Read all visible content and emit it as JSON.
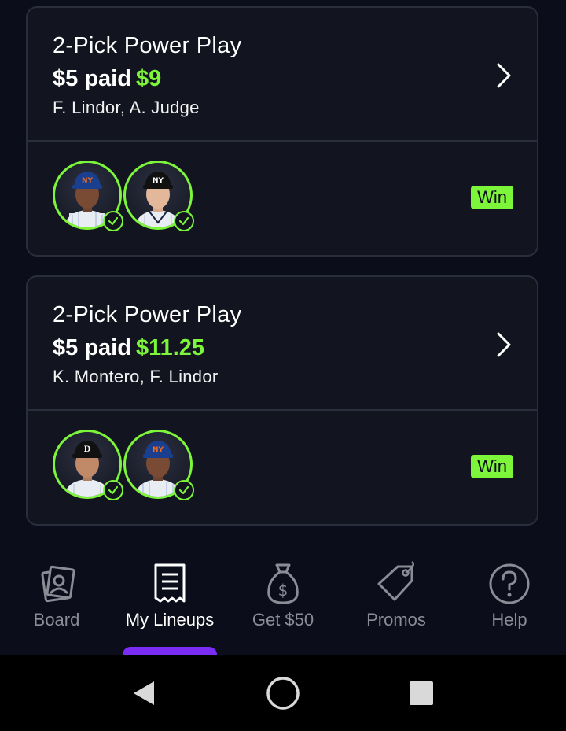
{
  "lineups": [
    {
      "title": "2-Pick Power Play",
      "paid_label": "$5 paid",
      "payout": "$9",
      "players": "F. Lindor, A. Judge",
      "avatars": [
        {
          "team": "mets",
          "cap_color": "#1b3f8f",
          "logo_color": "#f26b1d"
        },
        {
          "team": "yankees",
          "cap_color": "#111111",
          "logo_color": "#ffffff"
        }
      ],
      "result": "Win"
    },
    {
      "title": "2-Pick Power Play",
      "paid_label": "$5 paid",
      "payout": "$11.25",
      "players": "K. Montero, F. Lindor",
      "avatars": [
        {
          "team": "tigers",
          "cap_color": "#111111",
          "logo_color": "#ffffff"
        },
        {
          "team": "mets",
          "cap_color": "#1b3f8f",
          "logo_color": "#f26b1d"
        }
      ],
      "result": "Win"
    }
  ],
  "tabs": [
    {
      "label": "Board",
      "icon": "board-icon",
      "active": false
    },
    {
      "label": "My Lineups",
      "icon": "receipt-icon",
      "active": true
    },
    {
      "label": "Get $50",
      "icon": "money-bag-icon",
      "active": false
    },
    {
      "label": "Promos",
      "icon": "tag-icon",
      "active": false
    },
    {
      "label": "Help",
      "icon": "help-icon",
      "active": false
    }
  ],
  "colors": {
    "accent_green": "#7cf53a",
    "active_tab": "#7b2cf5",
    "card_bg": "#12141f",
    "page_bg": "#0b0d1a"
  },
  "system_nav": [
    "back-icon",
    "home-icon",
    "recents-icon"
  ]
}
